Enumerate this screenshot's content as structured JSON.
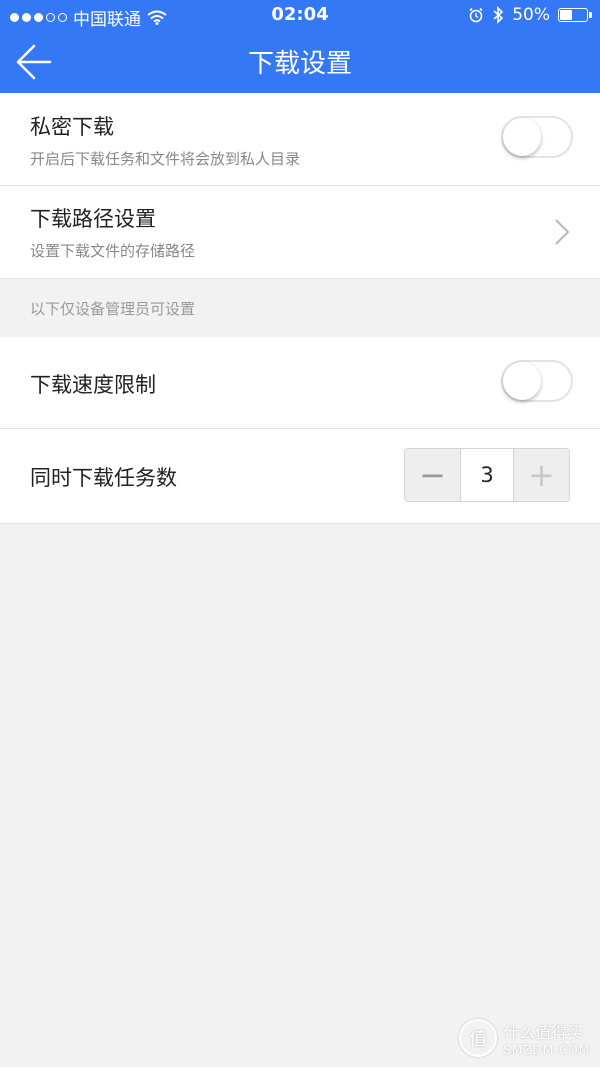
{
  "status_bar": {
    "carrier": "中国联通",
    "time": "02:04",
    "battery": "50%",
    "battery_level": 0.5
  },
  "nav": {
    "title": "下载设置",
    "back_icon": "back-arrow-icon"
  },
  "settings": {
    "private_download": {
      "title": "私密下载",
      "subtitle": "开启后下载任务和文件将会放到私人目录",
      "enabled": false
    },
    "download_path": {
      "title": "下载路径设置",
      "subtitle": "设置下载文件的存储路径"
    },
    "admin_section_label": "以下仅设备管理员可设置",
    "speed_limit": {
      "title": "下载速度限制",
      "enabled": false
    },
    "concurrent_tasks": {
      "title": "同时下载任务数",
      "value": "3",
      "minus_label": "−",
      "plus_label": "+"
    }
  },
  "watermark": {
    "badge": "值",
    "line1": "什么值得买",
    "line2": "SMZDM.COM"
  },
  "colors": {
    "accent": "#3478f6",
    "background": "#f2f2f2"
  }
}
